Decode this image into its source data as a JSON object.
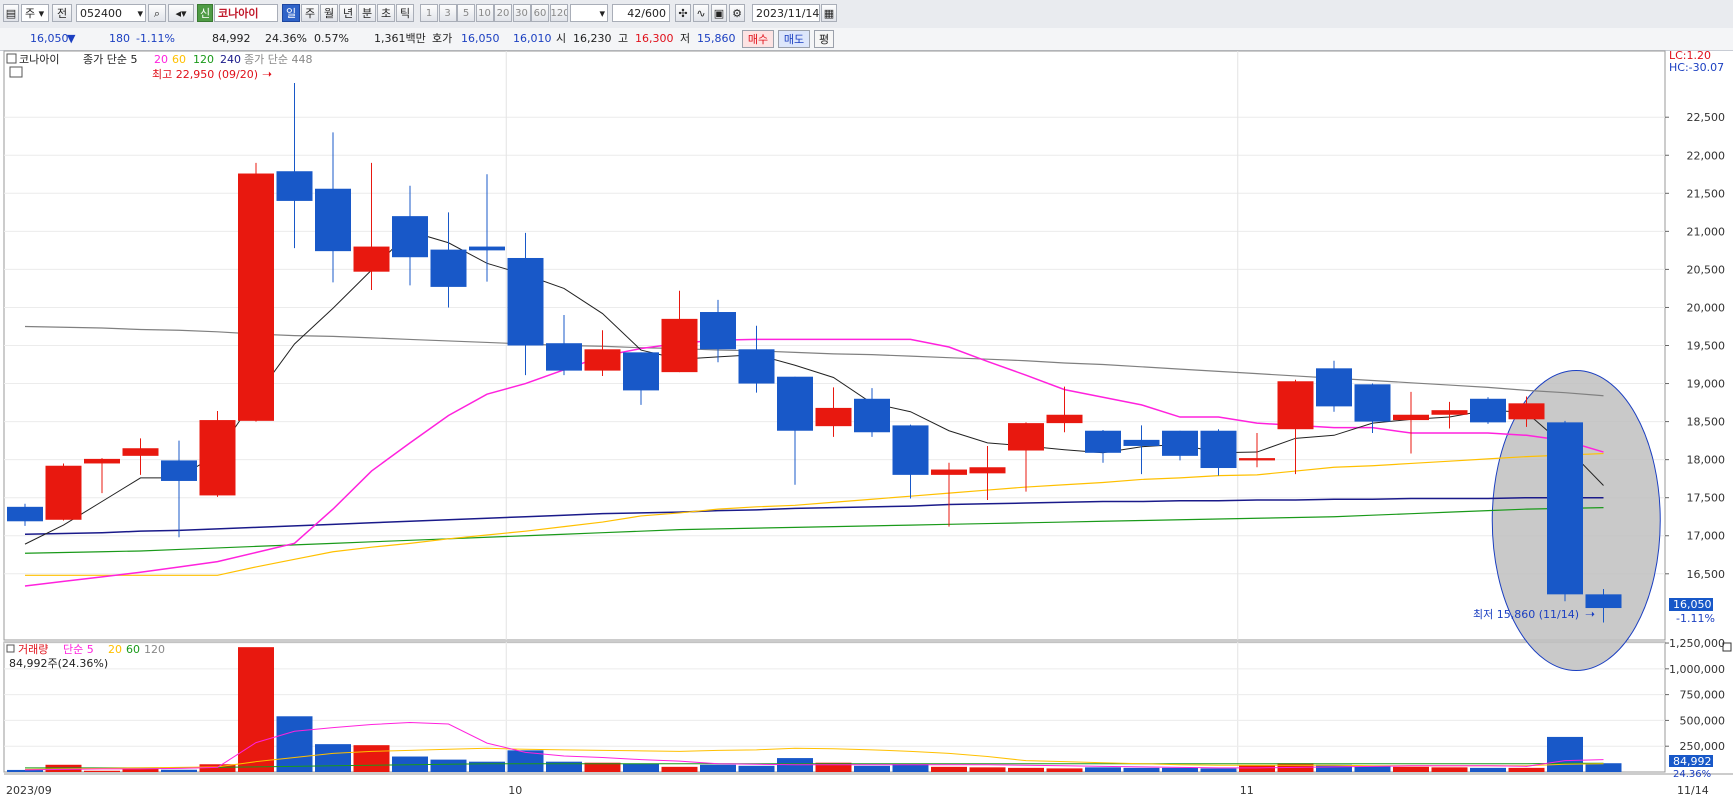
{
  "toolbar": {
    "period_select": "주",
    "prev_label": "전",
    "code": "052400",
    "new_badge": "신",
    "stock_name": "코나아이",
    "periods": [
      "일",
      "주",
      "월",
      "년",
      "분",
      "초",
      "틱"
    ],
    "active_period": "일",
    "minute_units": [
      "1",
      "3",
      "5",
      "10",
      "20",
      "30",
      "60",
      "120"
    ],
    "count": "42/600",
    "date": "2023/11/14"
  },
  "info": {
    "price": "16,050",
    "change": "180",
    "change_pct": "-1.11%",
    "volume": "84,992",
    "vol_ratio": "24.36%",
    "turnover": "0.57%",
    "amount": "1,361백만",
    "quote_label": "호가",
    "ask": "16,050",
    "bid": "16,010",
    "open_label": "시",
    "open": "16,230",
    "high_label": "고",
    "high": "16,300",
    "low_label": "저",
    "low": "15,860",
    "buy_label": "매수",
    "sell_label": "매도",
    "avg_label": "평"
  },
  "legend": {
    "name": "코나아이",
    "ma_label": "종가 단순 5",
    "ma_periods": [
      "20",
      "60",
      "120",
      "240"
    ],
    "ma_extra": "종가 단순 448",
    "max_label": "최고 22,950 (09/20)",
    "min_label": "최저 15,860 (11/14)",
    "lc": "LC:1.20",
    "hc": "HC:-30.07",
    "current_price": "16,050",
    "current_change": "-1.11%"
  },
  "volume_legend": {
    "title": "거래량",
    "ma_label": "단순 5",
    "ma_periods": [
      "20",
      "60",
      "120"
    ],
    "current": "84,992주(24.36%)",
    "current_tag": "84,992",
    "current_ratio": "24.36%"
  },
  "x_labels": [
    {
      "index": 0,
      "label": "2023/09"
    },
    {
      "index": 13,
      "label": "10"
    },
    {
      "index": 32,
      "label": "11"
    },
    {
      "index": 41,
      "label": "11/14"
    }
  ],
  "colors": {
    "up": "#e8180f",
    "down": "#1858c8",
    "ma5": "#222222",
    "ma20": "#ff22dd",
    "ma60": "#ffc000",
    "ma120": "#1a9a1a",
    "ma240": "#1a1a8a",
    "ma448": "#808080",
    "ellipse": "#bfbfbf"
  },
  "chart_data": [
    {
      "type": "candlestick",
      "title": "코나아이",
      "y_ticks": [
        16500,
        17000,
        17500,
        18000,
        18500,
        19000,
        19500,
        20000,
        20500,
        21000,
        21500,
        22000,
        22500
      ],
      "ylim": [
        15630,
        23370
      ],
      "candles": [
        {
          "o": 17380,
          "h": 17420,
          "l": 17130,
          "c": 17190
        },
        {
          "o": 17210,
          "h": 17950,
          "l": 17200,
          "c": 17920
        },
        {
          "o": 17950,
          "h": 18020,
          "l": 17560,
          "c": 18010
        },
        {
          "o": 18050,
          "h": 18280,
          "l": 17800,
          "c": 18150
        },
        {
          "o": 17990,
          "h": 18250,
          "l": 16980,
          "c": 17720
        },
        {
          "o": 17530,
          "h": 18640,
          "l": 17510,
          "c": 18520
        },
        {
          "o": 18510,
          "h": 21900,
          "l": 18500,
          "c": 21760
        },
        {
          "o": 21790,
          "h": 22950,
          "l": 20780,
          "c": 21400
        },
        {
          "o": 21560,
          "h": 22300,
          "l": 20330,
          "c": 20740
        },
        {
          "o": 20470,
          "h": 21900,
          "l": 20230,
          "c": 20800
        },
        {
          "o": 21200,
          "h": 21600,
          "l": 20290,
          "c": 20660
        },
        {
          "o": 20760,
          "h": 21250,
          "l": 20000,
          "c": 20270
        },
        {
          "o": 20800,
          "h": 21750,
          "l": 20340,
          "c": 20750
        },
        {
          "o": 20650,
          "h": 20980,
          "l": 19110,
          "c": 19500
        },
        {
          "o": 19530,
          "h": 19900,
          "l": 19110,
          "c": 19170
        },
        {
          "o": 19170,
          "h": 19700,
          "l": 19100,
          "c": 19450
        },
        {
          "o": 19410,
          "h": 19410,
          "l": 18720,
          "c": 18910
        },
        {
          "o": 19150,
          "h": 20220,
          "l": 19150,
          "c": 19850
        },
        {
          "o": 19940,
          "h": 20100,
          "l": 19280,
          "c": 19450
        },
        {
          "o": 19450,
          "h": 19760,
          "l": 18880,
          "c": 19000
        },
        {
          "o": 19090,
          "h": 19090,
          "l": 17670,
          "c": 18380
        },
        {
          "o": 18440,
          "h": 18950,
          "l": 18300,
          "c": 18680
        },
        {
          "o": 18800,
          "h": 18940,
          "l": 18300,
          "c": 18360
        },
        {
          "o": 18450,
          "h": 18460,
          "l": 17490,
          "c": 17800
        },
        {
          "o": 17800,
          "h": 17960,
          "l": 17120,
          "c": 17870
        },
        {
          "o": 17820,
          "h": 18180,
          "l": 17470,
          "c": 17900
        },
        {
          "o": 18120,
          "h": 18490,
          "l": 17580,
          "c": 18480
        },
        {
          "o": 18480,
          "h": 18960,
          "l": 18360,
          "c": 18590
        },
        {
          "o": 18380,
          "h": 18390,
          "l": 17960,
          "c": 18090
        },
        {
          "o": 18260,
          "h": 18450,
          "l": 17810,
          "c": 18180
        },
        {
          "o": 18380,
          "h": 18380,
          "l": 17990,
          "c": 18050
        },
        {
          "o": 18380,
          "h": 18400,
          "l": 17790,
          "c": 17890
        },
        {
          "o": 17990,
          "h": 18350,
          "l": 17900,
          "c": 18020
        },
        {
          "o": 18400,
          "h": 19050,
          "l": 17810,
          "c": 19030
        },
        {
          "o": 19200,
          "h": 19300,
          "l": 18630,
          "c": 18700
        },
        {
          "o": 18990,
          "h": 19000,
          "l": 18350,
          "c": 18500
        },
        {
          "o": 18520,
          "h": 18890,
          "l": 18080,
          "c": 18590
        },
        {
          "o": 18590,
          "h": 18760,
          "l": 18410,
          "c": 18650
        },
        {
          "o": 18800,
          "h": 18820,
          "l": 18470,
          "c": 18490
        },
        {
          "o": 18530,
          "h": 18830,
          "l": 18430,
          "c": 18740
        },
        {
          "o": 18490,
          "h": 18510,
          "l": 16140,
          "c": 16230
        },
        {
          "o": 16230,
          "h": 16300,
          "l": 15860,
          "c": 16050
        }
      ],
      "ma5": [
        16890,
        17140,
        17450,
        17760,
        17760,
        18080,
        18830,
        19520,
        19990,
        20490,
        21000,
        20850,
        20580,
        20430,
        20250,
        19920,
        19440,
        19320,
        19350,
        19380,
        19240,
        19080,
        18740,
        18630,
        18380,
        18220,
        18180,
        18130,
        18090,
        18170,
        18200,
        18090,
        18100,
        18280,
        18320,
        18480,
        18530,
        18560,
        18650,
        18620,
        18180,
        17660
      ],
      "ma20": [
        16340,
        16400,
        16460,
        16520,
        16590,
        16660,
        16780,
        16900,
        17350,
        17850,
        18220,
        18580,
        18860,
        19000,
        19180,
        19360,
        19460,
        19530,
        19570,
        19580,
        19580,
        19580,
        19580,
        19580,
        19480,
        19290,
        19110,
        18920,
        18820,
        18720,
        18560,
        18560,
        18480,
        18450,
        18420,
        18420,
        18350,
        18350,
        18350,
        18320,
        18250,
        18100
      ],
      "ma60": [
        16480,
        16480,
        16480,
        16480,
        16480,
        16480,
        16590,
        16690,
        16790,
        16850,
        16900,
        16960,
        17010,
        17060,
        17120,
        17180,
        17260,
        17300,
        17350,
        17380,
        17400,
        17440,
        17480,
        17520,
        17560,
        17600,
        17640,
        17670,
        17700,
        17740,
        17760,
        17790,
        17800,
        17850,
        17900,
        17920,
        17950,
        17980,
        18010,
        18040,
        18060,
        18080
      ],
      "ma120": [
        16770,
        16780,
        16790,
        16800,
        16820,
        16840,
        16860,
        16880,
        16900,
        16920,
        16940,
        16960,
        16980,
        17000,
        17020,
        17040,
        17060,
        17080,
        17090,
        17100,
        17110,
        17120,
        17130,
        17140,
        17150,
        17160,
        17170,
        17180,
        17190,
        17200,
        17210,
        17220,
        17230,
        17240,
        17250,
        17270,
        17290,
        17310,
        17330,
        17350,
        17360,
        17370
      ],
      "ma240": [
        17020,
        17030,
        17040,
        17060,
        17070,
        17090,
        17110,
        17130,
        17150,
        17170,
        17190,
        17210,
        17230,
        17250,
        17270,
        17290,
        17300,
        17310,
        17330,
        17340,
        17360,
        17370,
        17380,
        17390,
        17410,
        17420,
        17430,
        17440,
        17450,
        17450,
        17460,
        17460,
        17470,
        17470,
        17480,
        17480,
        17490,
        17490,
        17490,
        17500,
        17500,
        17500
      ],
      "ma448": [
        19750,
        19740,
        19730,
        19710,
        19700,
        19680,
        19650,
        19630,
        19620,
        19600,
        19580,
        19560,
        19540,
        19520,
        19500,
        19490,
        19470,
        19460,
        19440,
        19430,
        19410,
        19390,
        19380,
        19360,
        19340,
        19320,
        19300,
        19270,
        19250,
        19220,
        19190,
        19160,
        19130,
        19100,
        19070,
        19040,
        19010,
        18980,
        18950,
        18910,
        18880,
        18840
      ]
    },
    {
      "type": "bar",
      "title": "거래량",
      "y_ticks": [
        250000,
        500000,
        750000,
        1000000,
        1250000
      ],
      "ylim": [
        0,
        1260000
      ],
      "values": [
        20000,
        70000,
        12000,
        30000,
        22000,
        75000,
        1210000,
        540000,
        270000,
        260000,
        150000,
        120000,
        100000,
        210000,
        100000,
        90000,
        80000,
        50000,
        70000,
        60000,
        135000,
        90000,
        60000,
        80000,
        50000,
        45000,
        40000,
        35000,
        45000,
        40000,
        40000,
        35000,
        65000,
        85000,
        70000,
        55000,
        50000,
        45000,
        40000,
        40000,
        340000,
        84992
      ],
      "ma5": [
        20000,
        25000,
        30000,
        30000,
        35000,
        45000,
        285000,
        395000,
        430000,
        460000,
        480000,
        465000,
        280000,
        190000,
        155000,
        140000,
        120000,
        105000,
        80000,
        75000,
        70000,
        70000,
        70000,
        70000,
        70000,
        70000,
        65000,
        60000,
        55000,
        50000,
        45000,
        40000,
        40000,
        45000,
        50000,
        55000,
        60000,
        60000,
        60000,
        55000,
        110000,
        120000
      ],
      "ma20": [
        25000,
        30000,
        35000,
        40000,
        45000,
        50000,
        100000,
        140000,
        180000,
        200000,
        210000,
        220000,
        230000,
        220000,
        215000,
        210000,
        205000,
        200000,
        210000,
        215000,
        230000,
        225000,
        215000,
        200000,
        180000,
        150000,
        110000,
        100000,
        90000,
        80000,
        70000,
        65000,
        65000,
        65000,
        65000,
        60000,
        60000,
        60000,
        60000,
        60000,
        75000,
        80000
      ],
      "ma60": [
        40000,
        40000,
        40000,
        40000,
        40000,
        45000,
        50000,
        55000,
        60000,
        65000,
        70000,
        75000,
        80000,
        80000,
        80000,
        80000,
        80000,
        80000,
        80000,
        80000,
        80000,
        80000,
        80000,
        80000,
        80000,
        80000,
        80000,
        80000,
        80000,
        80000,
        80000,
        80000,
        80000,
        80000,
        80000,
        80000,
        80000,
        80000,
        80000,
        80000,
        85000,
        85000
      ]
    }
  ]
}
